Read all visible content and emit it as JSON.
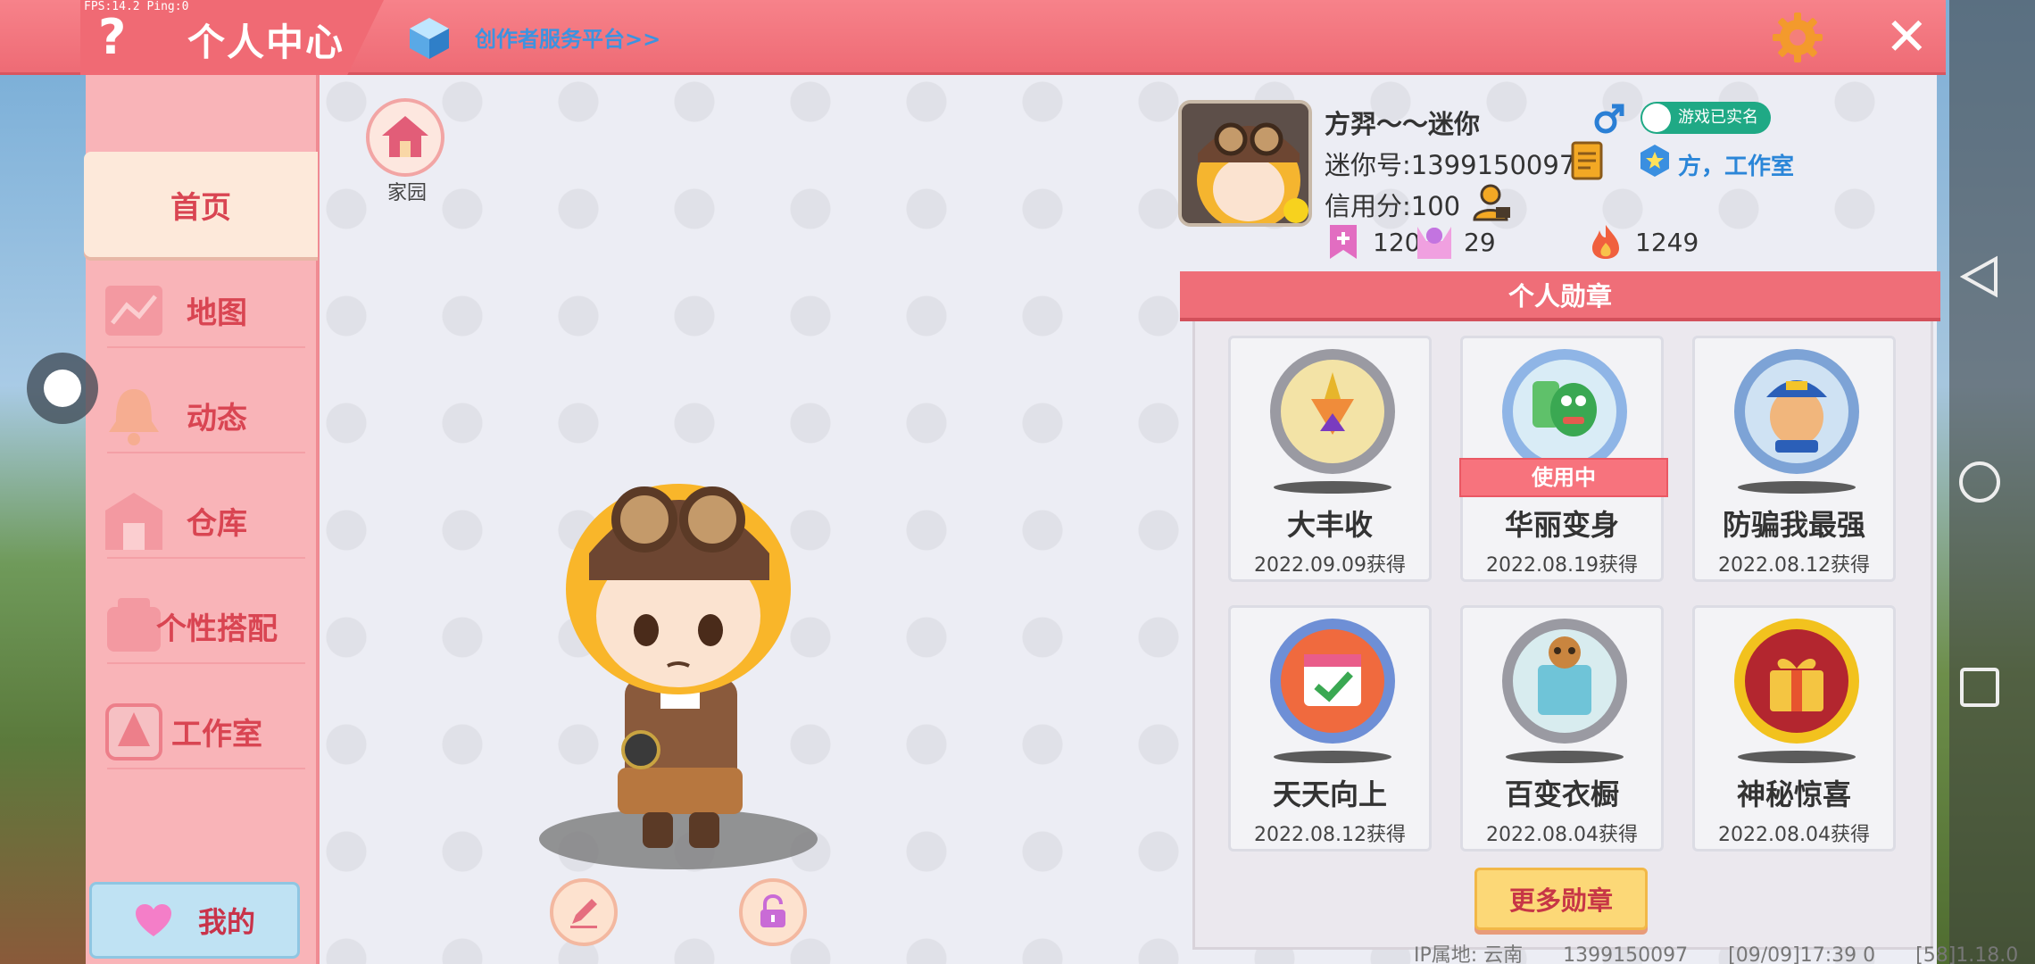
{
  "status": {
    "fps_text": "FPS:14.2  Ping:0"
  },
  "header": {
    "help_label": "?",
    "title": "个人中心",
    "creator_link": "创作者服务平台>>",
    "close_label": "✕"
  },
  "sidebar": {
    "items": [
      {
        "label": "首页",
        "active": true
      },
      {
        "label": "地图"
      },
      {
        "label": "动态"
      },
      {
        "label": "仓库"
      },
      {
        "label": "个性搭配"
      },
      {
        "label": "工作室"
      }
    ],
    "my_button": "我的"
  },
  "home": {
    "label": "家园"
  },
  "profile": {
    "nickname": "方羿～～迷你",
    "verified": "游戏已实名",
    "mini_id": "迷你号:1399150097",
    "studio": "方，工作室",
    "credit": "信用分:100",
    "stats": {
      "favorites": "120",
      "fans": "29",
      "popularity": "1249"
    }
  },
  "medals": {
    "title": "个人勋章",
    "in_use_label": "使用中",
    "items": [
      {
        "name": "大丰收",
        "date": "2022.09.09获得"
      },
      {
        "name": "华丽变身",
        "date": "2022.08.19获得",
        "in_use": true
      },
      {
        "name": "防骗我最强",
        "date": "2022.08.12获得"
      },
      {
        "name": "天天向上",
        "date": "2022.08.12获得"
      },
      {
        "name": "百变衣橱",
        "date": "2022.08.04获得"
      },
      {
        "name": "神秘惊喜",
        "date": "2022.08.04获得"
      }
    ],
    "more_button": "更多勋章"
  },
  "footer": {
    "ip": "IP属地: 云南",
    "uid": "1399150097",
    "time": "[09/09]17:39 0",
    "version": "[58]1.18.0"
  },
  "colors": {
    "header_red": "#ee6b75",
    "sidebar_pink": "#f9b4b8",
    "accent_blue": "#3d93e0",
    "verified_green": "#1fa985"
  }
}
